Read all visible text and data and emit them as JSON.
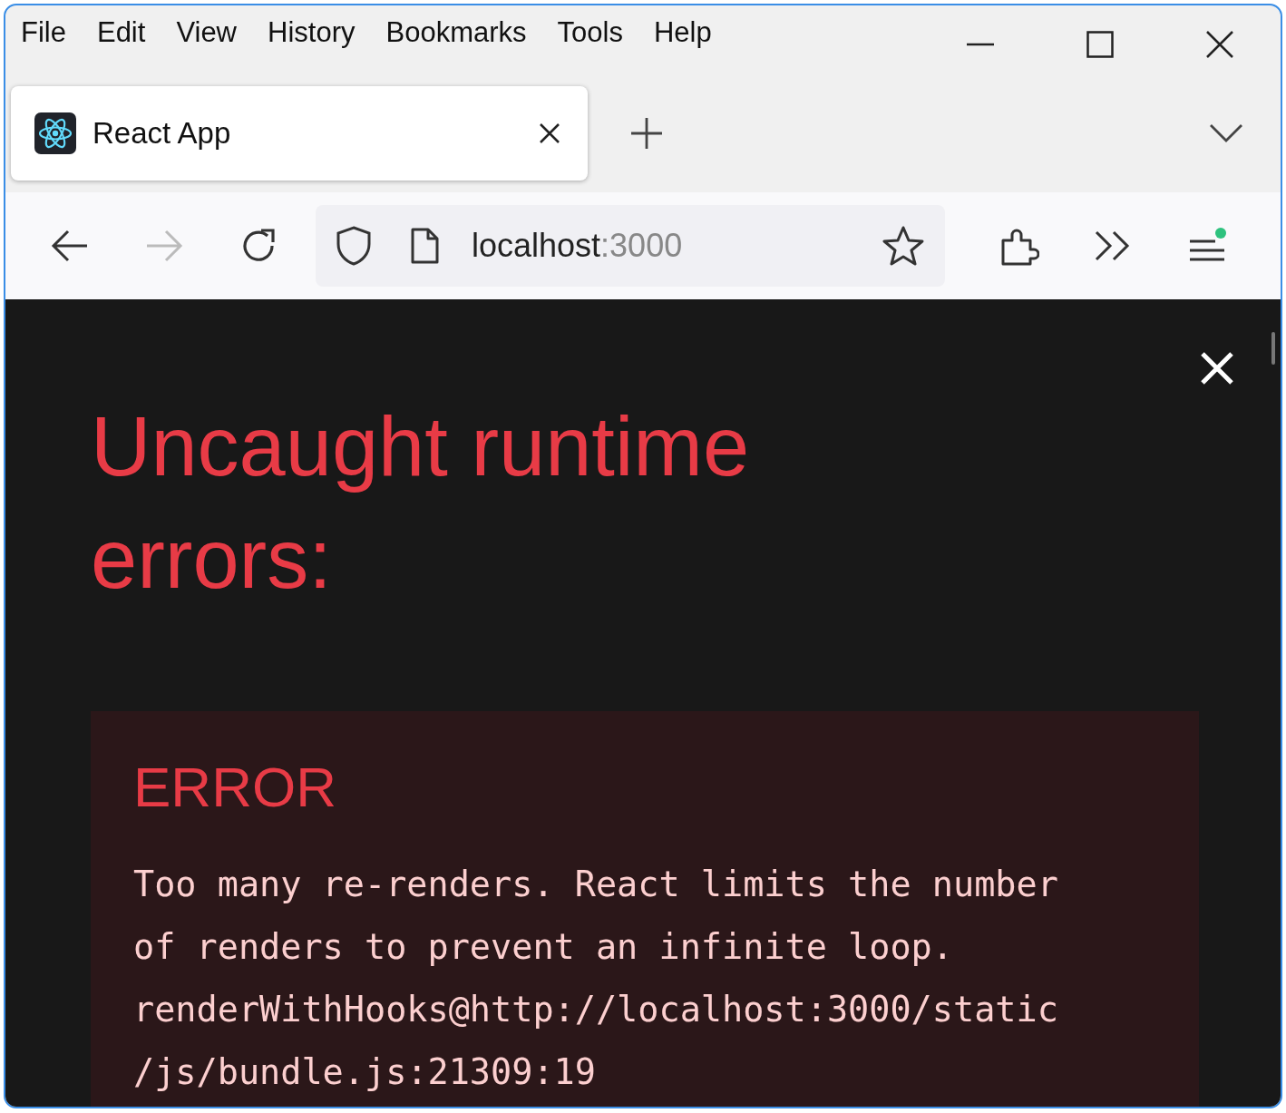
{
  "menu_bar": [
    "File",
    "Edit",
    "View",
    "History",
    "Bookmarks",
    "Tools",
    "Help"
  ],
  "tabs": [
    {
      "title": "React App",
      "selected": true
    }
  ],
  "nav_buttons": [
    {
      "kind": "back",
      "disabled": false
    },
    {
      "kind": "forward",
      "disabled": true
    },
    {
      "kind": "reload",
      "disabled": false
    }
  ],
  "address_bar": {
    "host": "localhost",
    "port": ":3000"
  },
  "overlay": {
    "heading": "Uncaught runtime errors:",
    "error": {
      "label": "ERROR",
      "message_lines": [
        "Too many re-renders. React limits the number",
        "of renders to prevent an infinite loop.",
        "renderWithHooks@http://localhost:3000/static",
        "/js/bundle.js:21309:19"
      ]
    }
  }
}
